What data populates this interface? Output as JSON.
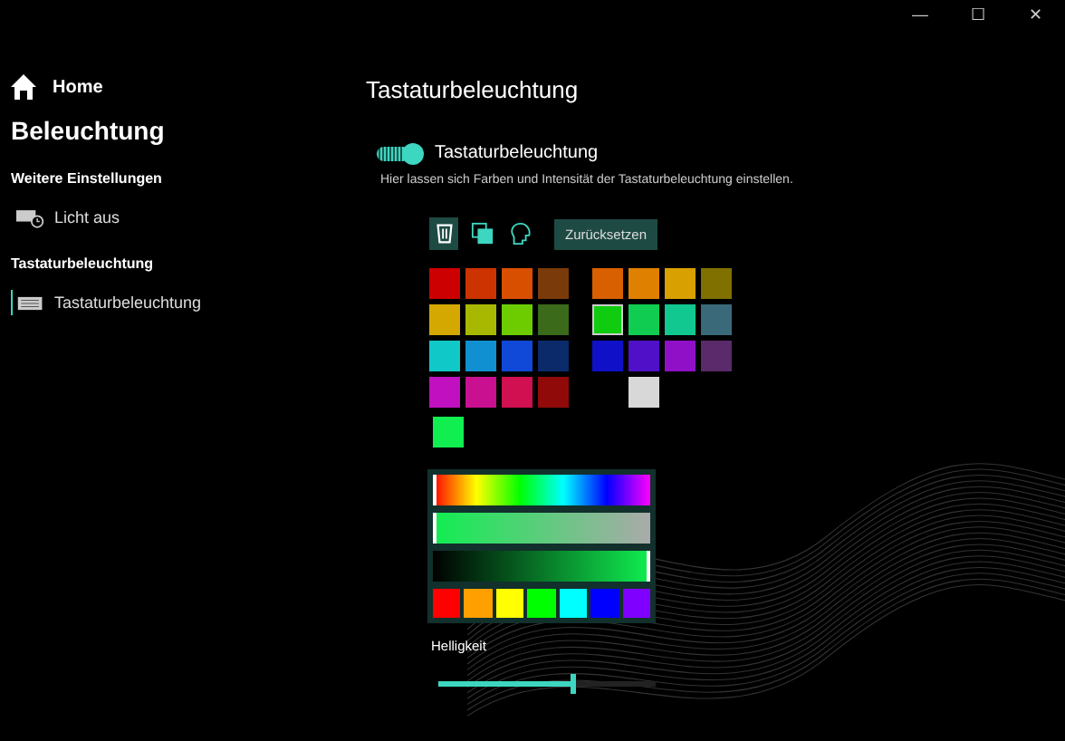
{
  "window": {
    "controls": [
      "—",
      "☐",
      "✕"
    ]
  },
  "sidebar": {
    "home": "Home",
    "title": "Beleuchtung",
    "sections": [
      {
        "heading": "Weitere Einstellungen",
        "items": [
          {
            "label": "Licht aus",
            "kind": "lightoff",
            "selected": false
          }
        ]
      },
      {
        "heading": "Tastaturbeleuchtung",
        "items": [
          {
            "label": "Tastaturbeleuchtung",
            "kind": "keyboard",
            "selected": true
          }
        ]
      }
    ]
  },
  "main": {
    "title": "Tastaturbeleuchtung",
    "toggle": {
      "label": "Tastaturbeleuchtung",
      "on": true
    },
    "description": "Hier lassen sich Farben und Intensität der Tastaturbeleuchtung einstellen.",
    "tools": [
      {
        "kind": "bucket",
        "selected": true
      },
      {
        "kind": "copy",
        "selected": false
      },
      {
        "kind": "head",
        "selected": false
      }
    ],
    "reset_button": "Zurücksetzen",
    "swatch_groups": [
      [
        {
          "color": "#cc0000",
          "selected": false
        },
        {
          "color": "#cc3300",
          "selected": false
        },
        {
          "color": "#d94f00",
          "selected": false
        },
        {
          "color": "#7a3a0a",
          "selected": false
        },
        {
          "color": "#d4a800",
          "selected": false
        },
        {
          "color": "#a8b800",
          "selected": false
        },
        {
          "color": "#6ccc00",
          "selected": false
        },
        {
          "color": "#3a6a1a",
          "selected": false
        },
        {
          "color": "#10c8c8",
          "selected": false
        },
        {
          "color": "#1090d0",
          "selected": false
        },
        {
          "color": "#1048d8",
          "selected": false
        },
        {
          "color": "#0a2a6a",
          "selected": false
        },
        {
          "color": "#c010c0",
          "selected": false
        },
        {
          "color": "#c81090",
          "selected": false
        },
        {
          "color": "#d01050",
          "selected": false
        },
        {
          "color": "#900a0a",
          "selected": false
        }
      ],
      [
        {
          "color": "#d86000",
          "selected": false
        },
        {
          "color": "#e08000",
          "selected": false
        },
        {
          "color": "#d8a000",
          "selected": false
        },
        {
          "color": "#807000",
          "selected": false
        },
        {
          "color": "#10cc10",
          "selected": true
        },
        {
          "color": "#10cc50",
          "selected": false
        },
        {
          "color": "#10c890",
          "selected": false
        },
        {
          "color": "#3a6a7a",
          "selected": false
        },
        {
          "color": "#1010c8",
          "selected": false
        },
        {
          "color": "#5010c8",
          "selected": false
        },
        {
          "color": "#9010c8",
          "selected": false
        },
        {
          "color": "#5a2a6a",
          "selected": false
        },
        {
          "color": "#d8d8d8",
          "selected": false
        }
      ]
    ],
    "current_color": {
      "color": "#10ee50"
    },
    "hue": {
      "level": 0
    },
    "saturation": {
      "level": 0
    },
    "value": {
      "level": 1
    },
    "presets": [
      {
        "color": "#ff0000"
      },
      {
        "color": "#ffa000"
      },
      {
        "color": "#ffff00"
      },
      {
        "color": "#00ff00"
      },
      {
        "color": "#00ffff"
      },
      {
        "color": "#0000ff"
      },
      {
        "color": "#8000ff"
      }
    ],
    "brightness": {
      "label": "Helligkeit",
      "level": 0.62
    }
  }
}
